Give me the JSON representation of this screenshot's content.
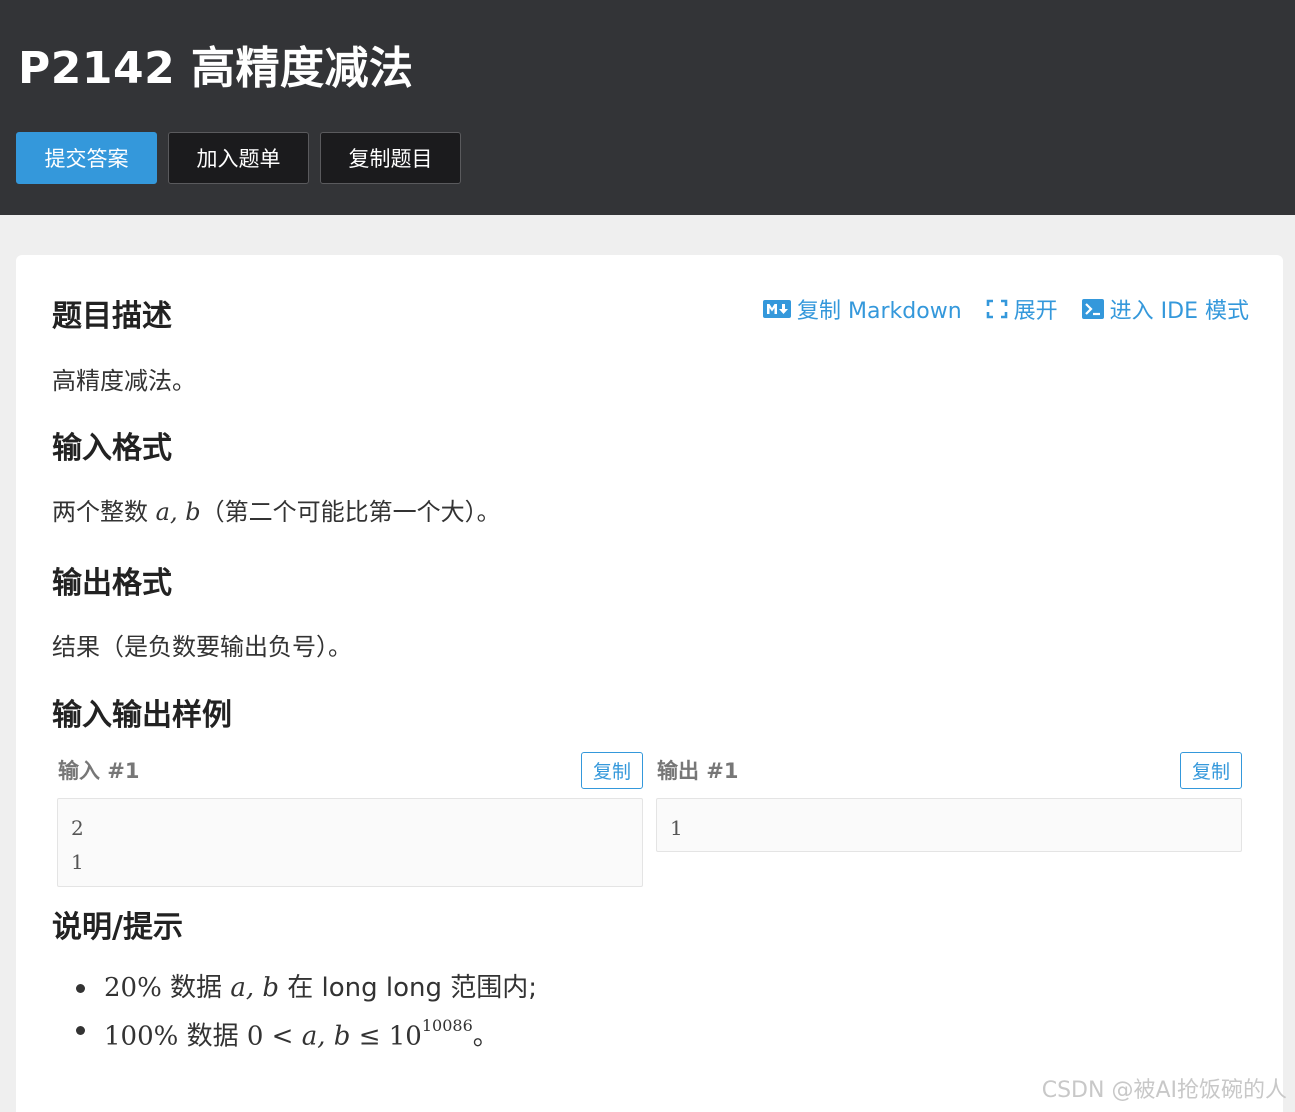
{
  "header": {
    "title": "P2142 高精度减法",
    "buttons": {
      "submit": "提交答案",
      "add_to_list": "加入题单",
      "copy_problem": "复制题目"
    }
  },
  "tools": {
    "copy_markdown": "复制 Markdown",
    "expand": "展开",
    "ide_mode": "进入 IDE 模式"
  },
  "sections": {
    "description": {
      "title": "题目描述",
      "text": "高精度减法。"
    },
    "input_format": {
      "title": "输入格式",
      "prefix": "两个整数 ",
      "math": "a, b",
      "suffix": "（第二个可能比第一个大）。"
    },
    "output_format": {
      "title": "输出格式",
      "text": "结果（是负数要输出负号）。"
    },
    "samples": {
      "title": "输入输出样例",
      "input_label": "输入 #1",
      "output_label": "输出 #1",
      "copy_label": "复制",
      "input_lines": [
        "2",
        "1"
      ],
      "output_lines": [
        "1"
      ]
    },
    "hints": {
      "title": "说明/提示",
      "item1": {
        "percent": "20%",
        "mid": " 数据 ",
        "math": "a, b",
        "suffix": " 在 long long 范围内;"
      },
      "item2": {
        "percent": "100%",
        "mid": " 数据 ",
        "zero": "0",
        "lt": " < ",
        "math": "a, b",
        "le": " ≤ ",
        "base": "10",
        "exp": "10086",
        "suffix": "。"
      }
    }
  },
  "watermark": "CSDN @被AI抢饭碗的人",
  "colors": {
    "accent": "#3498db",
    "header_bg": "#333437"
  }
}
